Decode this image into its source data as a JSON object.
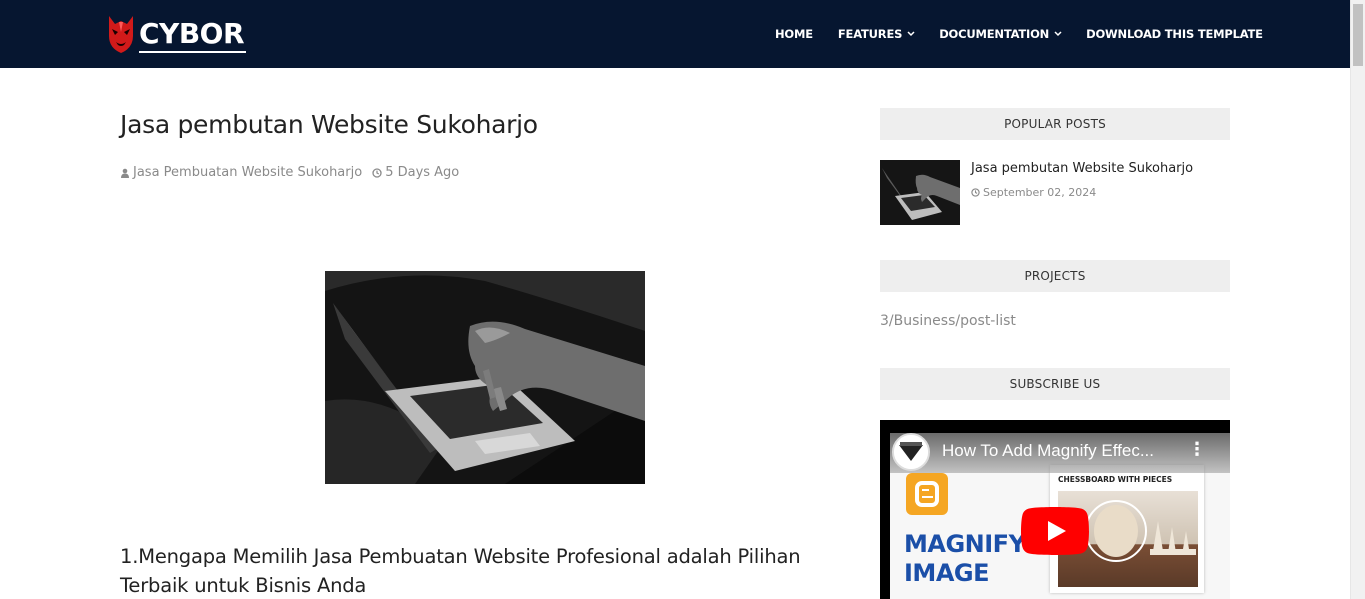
{
  "header": {
    "logo_text": "CYBOR",
    "nav": [
      {
        "label": "HOME"
      },
      {
        "label": "FEATURES"
      },
      {
        "label": "DOCUMENTATION"
      },
      {
        "label": "DOWNLOAD THIS TEMPLATE"
      }
    ],
    "background_color": "#061630"
  },
  "post": {
    "title": "Jasa pembutan Website Sukoharjo",
    "author": "Jasa Pembuatan Website Sukoharjo",
    "time_ago": "5 Days Ago",
    "heading_1": "1.Mengapa Memilih Jasa Pembuatan Website Profesional adalah Pilihan Terbaik untuk Bisnis Anda"
  },
  "sidebar": {
    "popular_posts": {
      "heading": "POPULAR POSTS",
      "items": [
        {
          "title": "Jasa pembutan Website Sukoharjo",
          "date": "September 02, 2024"
        }
      ]
    },
    "projects": {
      "heading": "PROJECTS",
      "text": "3/Business/post-list"
    },
    "subscribe": {
      "heading": "SUBSCRIBE US",
      "video": {
        "title": "How To Add Magnify Effec...",
        "overlay_heading": "MAGNIFY IMAGE",
        "card_label": "CHESSBOARD WITH PIECES",
        "play_color": "#ff0000"
      }
    }
  },
  "icons": {
    "author": "user-icon",
    "time": "clock-icon",
    "chevron": "chevron-down-icon"
  }
}
